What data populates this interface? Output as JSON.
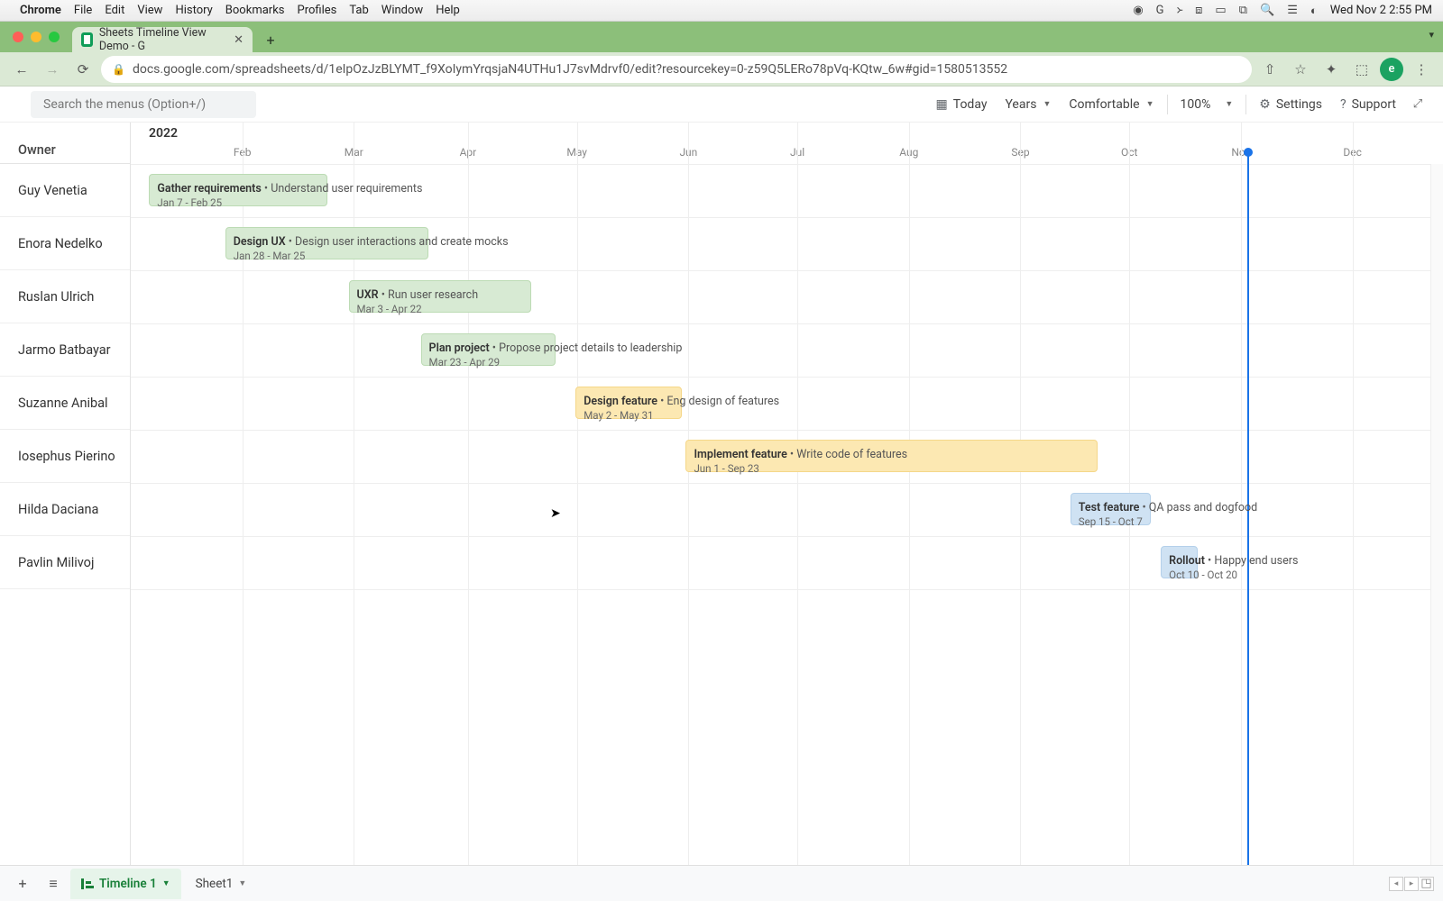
{
  "mac": {
    "app": "Chrome",
    "menus": [
      "File",
      "Edit",
      "View",
      "History",
      "Bookmarks",
      "Profiles",
      "Tab",
      "Window",
      "Help"
    ],
    "clock": "Wed Nov 2  2:55 PM"
  },
  "browser": {
    "tab_title": "Sheets Timeline View Demo - G",
    "url": "docs.google.com/spreadsheets/d/1eIpOzJzBLYMT_f9XoIymYrqsjaN4UTHu1J7svMdrvf0/edit?resourcekey=0-z59Q5LERo78pVq-KQtw_6w#gid=1580513552",
    "avatar_letter": "e"
  },
  "toolbar": {
    "search_placeholder": "Search the menus (Option+/)",
    "today": "Today",
    "scale": "Years",
    "density": "Comfortable",
    "zoom": "100%",
    "settings": "Settings",
    "support": "Support"
  },
  "timeline": {
    "owner_header": "Owner",
    "year": "2022",
    "months": [
      "Feb",
      "Mar",
      "Apr",
      "May",
      "Jun",
      "Jul",
      "Aug",
      "Sep",
      "Oct",
      "Nov",
      "Dec"
    ],
    "month_x_pct": [
      8.5,
      17.0,
      25.7,
      34.0,
      42.5,
      50.8,
      59.3,
      67.8,
      76.1,
      84.6,
      93.1
    ],
    "today_x_pct": 85.1,
    "owners": [
      "Guy Venetia",
      "Enora Nedelko",
      "Ruslan Ulrich",
      "Jarmo Batbayar",
      "Suzanne Anibal",
      "Iosephus Pierino",
      "Hilda Daciana",
      "Pavlin Milivoj"
    ],
    "tasks": [
      {
        "row": 0,
        "title": "Gather requirements",
        "desc": "Understand user requirements",
        "dates": "Jan 7 - Feb 25",
        "color": "green",
        "left_pct": 1.4,
        "width_pct": 13.6
      },
      {
        "row": 1,
        "title": "Design UX",
        "desc": "Design user interactions and create mocks",
        "dates": "Jan 28 - Mar 25",
        "color": "green",
        "left_pct": 7.2,
        "width_pct": 15.5
      },
      {
        "row": 2,
        "title": "UXR",
        "desc": "Run user research",
        "dates": "Mar 3 - Apr 22",
        "color": "green",
        "left_pct": 16.6,
        "width_pct": 13.9
      },
      {
        "row": 3,
        "title": "Plan project",
        "desc": "Propose project details to leadership",
        "dates": "Mar 23 - Apr 29",
        "color": "green",
        "left_pct": 22.1,
        "width_pct": 10.3
      },
      {
        "row": 4,
        "title": "Design feature",
        "desc": "Eng design of features",
        "dates": "May 2 - May 31",
        "color": "yellow",
        "left_pct": 33.9,
        "width_pct": 8.1
      },
      {
        "row": 5,
        "title": "Implement feature",
        "desc": "Write code of features",
        "dates": "Jun 1 - Sep 23",
        "color": "yellow",
        "left_pct": 42.3,
        "width_pct": 31.4
      },
      {
        "row": 6,
        "title": "Test feature",
        "desc": "QA pass and dogfood",
        "dates": "Sep 15 - Oct 7",
        "color": "blue",
        "left_pct": 71.6,
        "width_pct": 6.1
      },
      {
        "row": 7,
        "title": "Rollout",
        "desc": "Happy end users",
        "dates": "Oct 10 - Oct 20",
        "color": "blue",
        "left_pct": 78.5,
        "width_pct": 2.8
      }
    ]
  },
  "sheets": {
    "active": "Timeline 1",
    "other": "Sheet1"
  },
  "chart_data": {
    "type": "gantt",
    "year": 2022,
    "owners": [
      "Guy Venetia",
      "Enora Nedelko",
      "Ruslan Ulrich",
      "Jarmo Batbayar",
      "Suzanne Anibal",
      "Iosephus Pierino",
      "Hilda Daciana",
      "Pavlin Milivoj"
    ],
    "tasks": [
      {
        "owner": "Guy Venetia",
        "name": "Gather requirements",
        "description": "Understand user requirements",
        "start": "2022-01-07",
        "end": "2022-02-25",
        "color": "#d7ead3"
      },
      {
        "owner": "Enora Nedelko",
        "name": "Design UX",
        "description": "Design user interactions and create mocks",
        "start": "2022-01-28",
        "end": "2022-03-25",
        "color": "#d7ead3"
      },
      {
        "owner": "Ruslan Ulrich",
        "name": "UXR",
        "description": "Run user research",
        "start": "2022-03-03",
        "end": "2022-04-22",
        "color": "#d7ead3"
      },
      {
        "owner": "Jarmo Batbayar",
        "name": "Plan project",
        "description": "Propose project details to leadership",
        "start": "2022-03-23",
        "end": "2022-04-29",
        "color": "#d7ead3"
      },
      {
        "owner": "Suzanne Anibal",
        "name": "Design feature",
        "description": "Eng design of features",
        "start": "2022-05-02",
        "end": "2022-05-31",
        "color": "#fce8b2"
      },
      {
        "owner": "Iosephus Pierino",
        "name": "Implement feature",
        "description": "Write code of features",
        "start": "2022-06-01",
        "end": "2022-09-23",
        "color": "#fce8b2"
      },
      {
        "owner": "Hilda Daciana",
        "name": "Test feature",
        "description": "QA pass and dogfood",
        "start": "2022-09-15",
        "end": "2022-10-07",
        "color": "#cfe2f3"
      },
      {
        "owner": "Pavlin Milivoj",
        "name": "Rollout",
        "description": "Happy end users",
        "start": "2022-10-10",
        "end": "2022-10-20",
        "color": "#cfe2f3"
      }
    ],
    "today": "2022-11-02"
  }
}
